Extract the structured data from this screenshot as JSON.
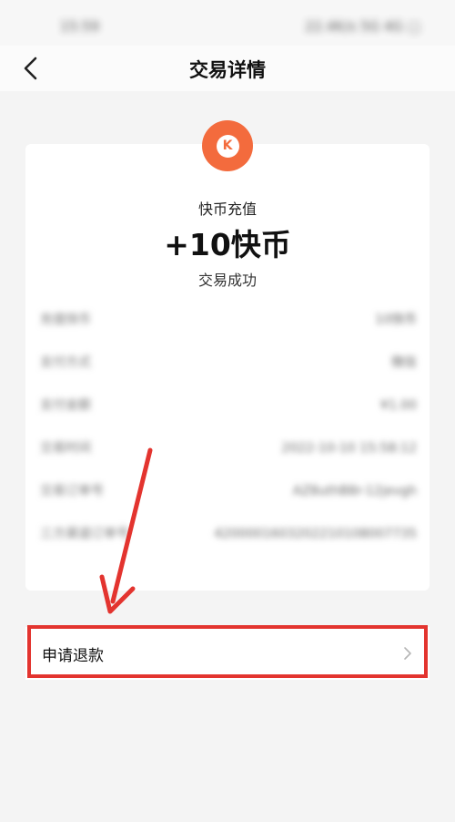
{
  "status_bar": {
    "time": "15:59",
    "indicators": "22.4K/s 5G 4G ▢"
  },
  "nav": {
    "title": "交易详情"
  },
  "transaction": {
    "coin_letter": "K",
    "item_name": "快币充值",
    "amount": "+10快币",
    "status": "交易成功"
  },
  "details": [
    {
      "label": "充值快币",
      "value": "10快币"
    },
    {
      "label": "支付方式",
      "value": "微信"
    },
    {
      "label": "支付金额",
      "value": "¥1.00"
    },
    {
      "label": "交易时间",
      "value": "2022-10-10 15:58:12"
    },
    {
      "label": "交易订单号",
      "value": "AZ8uthB8r-12jevgh"
    },
    {
      "label": "三方渠道订单号",
      "value": "4200001603202210108007735"
    }
  ],
  "refund": {
    "label": "申请退款"
  },
  "colors": {
    "accent": "#f36b3d",
    "annotation": "#e3342f"
  }
}
